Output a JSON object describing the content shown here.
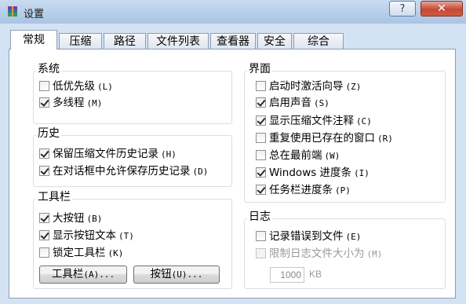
{
  "window": {
    "title": "设置",
    "help_glyph": "?",
    "close_glyph": "✕"
  },
  "tabs": [
    {
      "label": "常规",
      "active": true
    },
    {
      "label": "压缩",
      "active": false
    },
    {
      "label": "路径",
      "active": false
    },
    {
      "label": "文件列表",
      "active": false
    },
    {
      "label": "查看器",
      "active": false
    },
    {
      "label": "安全",
      "active": false
    },
    {
      "label": "综合",
      "active": false
    }
  ],
  "system": {
    "title": "系统",
    "items": [
      {
        "label": "低优先级",
        "hotkey": "(L)",
        "checked": false
      },
      {
        "label": "多线程",
        "hotkey": "(M)",
        "checked": true
      }
    ]
  },
  "history": {
    "title": "历史",
    "items": [
      {
        "label": "保留压缩文件历史记录",
        "hotkey": "(H)",
        "checked": true
      },
      {
        "label": "在对话框中允许保存历史记录",
        "hotkey": "(D)",
        "checked": true
      }
    ]
  },
  "toolbar": {
    "title": "工具栏",
    "items": [
      {
        "label": "大按钮",
        "hotkey": "(B)",
        "checked": true
      },
      {
        "label": "显示按钮文本",
        "hotkey": "(T)",
        "checked": true
      },
      {
        "label": "锁定工具栏",
        "hotkey": "(K)",
        "checked": false
      }
    ],
    "toolbar_button": {
      "label": "工具栏",
      "hotkey": "(A)..."
    },
    "buttons_button": {
      "label": "按钮",
      "hotkey": "(U)..."
    }
  },
  "interface": {
    "title": "界面",
    "items": [
      {
        "label": "启动时激活向导",
        "hotkey": "(Z)",
        "checked": false
      },
      {
        "label": "启用声音",
        "hotkey": "(S)",
        "checked": true
      },
      {
        "label": "显示压缩文件注释",
        "hotkey": "(C)",
        "checked": true
      },
      {
        "label": "重复使用已存在的窗口",
        "hotkey": "(R)",
        "checked": false
      },
      {
        "label": "总在最前端",
        "hotkey": "(W)",
        "checked": false
      },
      {
        "label": "Windows 进度条",
        "hotkey": "(I)",
        "checked": true
      },
      {
        "label": "任务栏进度条",
        "hotkey": "(P)",
        "checked": true
      }
    ]
  },
  "log": {
    "title": "日志",
    "items": [
      {
        "label": "记录错误到文件",
        "hotkey": "(E)",
        "checked": false,
        "disabled": false
      },
      {
        "label": "限制日志文件大小为",
        "hotkey": "(M)",
        "checked": false,
        "disabled": true
      }
    ],
    "size_value": "1000",
    "size_unit": "KB"
  },
  "colors": {
    "titlebar": "#a9c4e4",
    "close_button": "#c44a34",
    "dialog_background": "#d4e3f3"
  }
}
